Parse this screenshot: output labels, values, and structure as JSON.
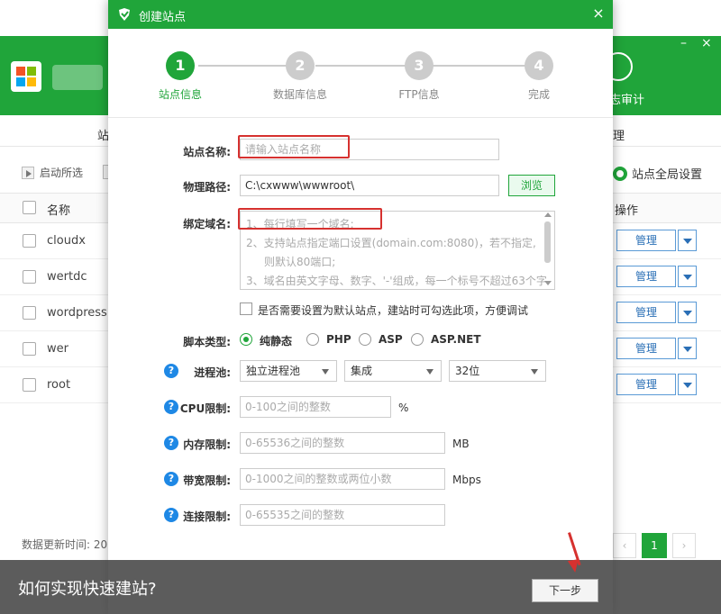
{
  "background": {
    "tab_left": "站",
    "tab_right": "理",
    "audit_label": "志审计",
    "toolbar_start_selected": "启动所选",
    "global_settings": "站点全局设置",
    "col_name": "名称",
    "col_ops": "操作",
    "rows": [
      {
        "name": "cloudx",
        "manage": "管理"
      },
      {
        "name": "wertdc",
        "manage": "管理"
      },
      {
        "name": "wordpress",
        "manage": "管理"
      },
      {
        "name": "wer",
        "manage": "管理"
      },
      {
        "name": "root",
        "manage": "管理"
      }
    ],
    "footer_text": "数据更新时间: 20",
    "pager_prev": "‹",
    "pager_current": "1",
    "pager_next": "›",
    "window_min": "–",
    "window_close": "×"
  },
  "modal": {
    "title": "创建站点",
    "close": "×",
    "steps": [
      {
        "num": "1",
        "label": "站点信息",
        "active": true
      },
      {
        "num": "2",
        "label": "数据库信息",
        "active": false
      },
      {
        "num": "3",
        "label": "FTP信息",
        "active": false
      },
      {
        "num": "4",
        "label": "完成",
        "active": false
      }
    ],
    "form": {
      "site_name_label": "站点名称:",
      "site_name_placeholder": "请输入站点名称",
      "path_label": "物理路径:",
      "path_value": "C:\\cxwww\\wwwroot\\",
      "browse_button": "浏览",
      "domain_label": "绑定域名:",
      "domain_hints": [
        "1、每行填写一个域名;",
        "2、支持站点指定端口设置(domain.com:8080)，若不指定,",
        "则默认80端口;",
        "3、域名由英文字母、数字、'-'组成，每一个标号不超过63个字"
      ],
      "default_site_text": "是否需要设置为默认站点，建站时可勾选此项，方便调试",
      "script_type_label": "脚本类型:",
      "script_types": [
        "纯静态",
        "PHP",
        "ASP",
        "ASP.NET"
      ],
      "script_selected": "纯静态",
      "pool_label": "进程池:",
      "pool_options": [
        "独立进程池",
        "集成",
        "32位"
      ],
      "cpu_label": "CPU限制:",
      "cpu_placeholder": "0-100之间的整数",
      "cpu_unit": "%",
      "mem_label": "内存限制:",
      "mem_placeholder": "0-65536之间的整数",
      "mem_unit": "MB",
      "bw_label": "带宽限制:",
      "bw_placeholder": "0-1000之间的整数或两位小数",
      "bw_unit": "Mbps",
      "conn_label": "连接限制:",
      "conn_placeholder": "0-65535之间的整数",
      "help_icon": "?"
    },
    "next_button": "下一步"
  },
  "caption": "如何实现快速建站?",
  "colors": {
    "accent": "#20a53a",
    "highlight": "#d6312f",
    "help": "#1e88e5"
  }
}
